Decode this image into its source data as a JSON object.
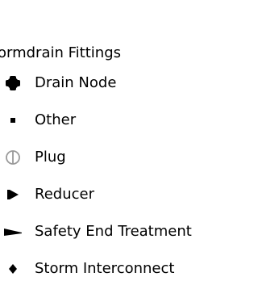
{
  "legend": {
    "title": "ormdrain Fittings",
    "items": [
      {
        "label": "Drain Node",
        "icon": "drain-node-cross-icon"
      },
      {
        "label": "Other",
        "icon": "other-dot-icon"
      },
      {
        "label": "Plug",
        "icon": "plug-circle-icon"
      },
      {
        "label": "Reducer",
        "icon": "reducer-icon"
      },
      {
        "label": "Safety End Treatment",
        "icon": "safety-end-treatment-icon"
      },
      {
        "label": "Storm Interconnect",
        "icon": "storm-interconnect-diamond-icon"
      }
    ]
  },
  "colors": {
    "symbol": "#000000",
    "plug_symbol": "#9a9a9a",
    "text": "#000000",
    "background": "#ffffff"
  }
}
